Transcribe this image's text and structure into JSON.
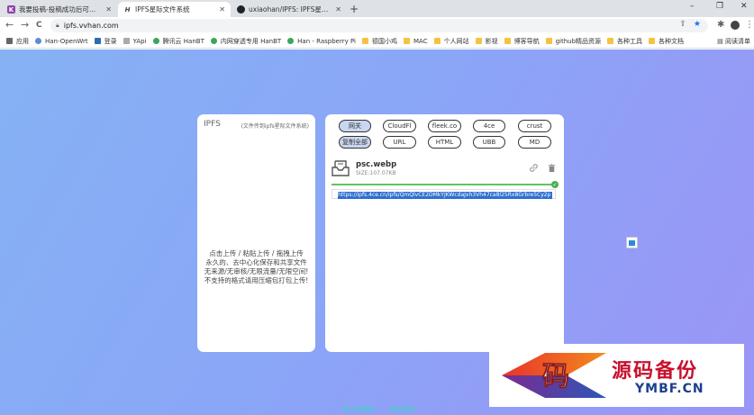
{
  "browser": {
    "tabs": [
      {
        "title": "我要投稿-投稿成功后可以领取完整…",
        "favicon": "K",
        "favicon_color": "#8e44ad"
      },
      {
        "title": "IPFS星际文件系统",
        "favicon": "H",
        "favicon_color": "#444444"
      },
      {
        "title": "uxiaohan/IPFS: IPFS星际文件系…",
        "favicon": "github-icon",
        "favicon_color": "#222222"
      }
    ],
    "new_tab": "+",
    "window_controls": {
      "minimize": "–",
      "restore": "❐",
      "close": "✕"
    },
    "nav": {
      "back": "←",
      "forward": "→",
      "reload": "C"
    },
    "url": "ipfs.vvhan.com",
    "bookmarks": [
      {
        "label": "应用",
        "icon": "grid-icon"
      },
      {
        "label": "Han-OpenWrt",
        "icon": "globe-icon"
      },
      {
        "label": "登录",
        "icon": "router-icon"
      },
      {
        "label": "YApi",
        "icon": "yapi-icon"
      },
      {
        "label": "腾讯云 HanBT",
        "icon": "green-shield-icon"
      },
      {
        "label": "内网穿透专用 HanBT",
        "icon": "green-shield-icon"
      },
      {
        "label": "Han - Raspberry Pi",
        "icon": "green-shield-icon"
      },
      {
        "label": "德国小鸡",
        "icon": "folder-icon"
      },
      {
        "label": "MAC",
        "icon": "folder-icon"
      },
      {
        "label": "个人网站",
        "icon": "folder-icon"
      },
      {
        "label": "影视",
        "icon": "folder-icon"
      },
      {
        "label": "博客导航",
        "icon": "folder-icon"
      },
      {
        "label": "github精品资源",
        "icon": "folder-icon"
      },
      {
        "label": "各种工具",
        "icon": "folder-icon"
      },
      {
        "label": "各种文档",
        "icon": "folder-icon"
      }
    ],
    "reading_list": "阅读清单"
  },
  "left_panel": {
    "title": "IPFS",
    "subtitle": "(文件传到ipfs星际文件系统)",
    "instructions": [
      "点击上传 / 粘贴上传 / 拖拽上传",
      "永久的、去中心化保存和共享文件",
      "无来源/无审核/无限流量/无限空间!",
      "不支持的格式请用压缩包打包上传!"
    ]
  },
  "gateways": [
    {
      "label": "网关",
      "selected": true
    },
    {
      "label": "CloudFl",
      "selected": false
    },
    {
      "label": "fleek.co",
      "selected": false
    },
    {
      "label": "4ce",
      "selected": false
    },
    {
      "label": "crust",
      "selected": false
    }
  ],
  "formats": [
    {
      "label": "复制全部",
      "selected": true
    },
    {
      "label": "URL",
      "selected": false
    },
    {
      "label": "HTML",
      "selected": false
    },
    {
      "label": "UBB",
      "selected": false
    },
    {
      "label": "MD",
      "selected": false
    }
  ],
  "file": {
    "name": "psc.webp",
    "size": "SIZE:107.07KB",
    "progress": 1.0,
    "link": "https://ipfs.4ce.cn/ipfs/QmQlvCE2DMkYJKWcdaJxh3Vh47ca8l25Rx8Grbre5Cy2p"
  },
  "footer": {
    "left": "韩小韩博客",
    "right": "网站源码"
  },
  "watermark": {
    "logo_glyph": "码",
    "cn": "源码备份",
    "en": "YMBF.CN"
  },
  "colors": {
    "accent_green": "#62c462",
    "footer_link": "#3fd4c3",
    "selection_blue": "#2f6fd1"
  }
}
